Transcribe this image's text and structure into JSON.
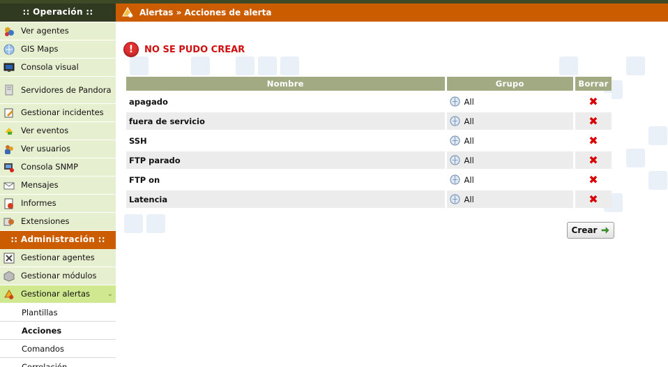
{
  "sidebar": {
    "operation_title": ":: Operación ::",
    "operation_items": [
      {
        "label": "Ver agentes",
        "icon": "agents-icon"
      },
      {
        "label": "GIS Maps",
        "icon": "globe-icon"
      },
      {
        "label": "Consola visual",
        "icon": "monitor-icon"
      },
      {
        "label": "Servidores de Pandora",
        "icon": "server-icon"
      },
      {
        "label": "Gestionar incidentes",
        "icon": "incident-icon"
      },
      {
        "label": "Ver eventos",
        "icon": "events-icon"
      },
      {
        "label": "Ver usuarios",
        "icon": "users-icon"
      },
      {
        "label": "Consola SNMP",
        "icon": "snmp-icon"
      },
      {
        "label": "Mensajes",
        "icon": "mail-icon"
      },
      {
        "label": "Informes",
        "icon": "reports-icon"
      },
      {
        "label": "Extensiones",
        "icon": "extensions-icon"
      }
    ],
    "admin_title": ":: Administración ::",
    "admin_items": [
      {
        "label": "Gestionar agentes",
        "icon": "manage-agents-icon"
      },
      {
        "label": "Gestionar módulos",
        "icon": "modules-icon"
      },
      {
        "label": "Gestionar alertas",
        "icon": "alerts-icon"
      }
    ],
    "alert_subitems": [
      {
        "label": "Plantillas"
      },
      {
        "label": "Acciones"
      },
      {
        "label": "Comandos"
      },
      {
        "label": "Correlación"
      }
    ]
  },
  "header": {
    "title": "Alertas » Acciones de alerta",
    "icon": "alerts-header-icon"
  },
  "error": {
    "message": "NO SE PUDO CREAR"
  },
  "table": {
    "columns": [
      "Nombre",
      "Grupo",
      "Borrar"
    ],
    "rows": [
      {
        "name": "apagado",
        "group": "All"
      },
      {
        "name": "fuera de servicio",
        "group": "All"
      },
      {
        "name": "SSH",
        "group": "All"
      },
      {
        "name": "FTP parado",
        "group": "All"
      },
      {
        "name": "FTP on",
        "group": "All"
      },
      {
        "name": "Latencia",
        "group": "All"
      }
    ]
  },
  "actions": {
    "create_label": "Crear"
  },
  "colors": {
    "brand_orange": "#cc5c00",
    "sidebar_bg": "#e6efcf",
    "table_header": "#a1aa82",
    "error_red": "#d01010"
  }
}
